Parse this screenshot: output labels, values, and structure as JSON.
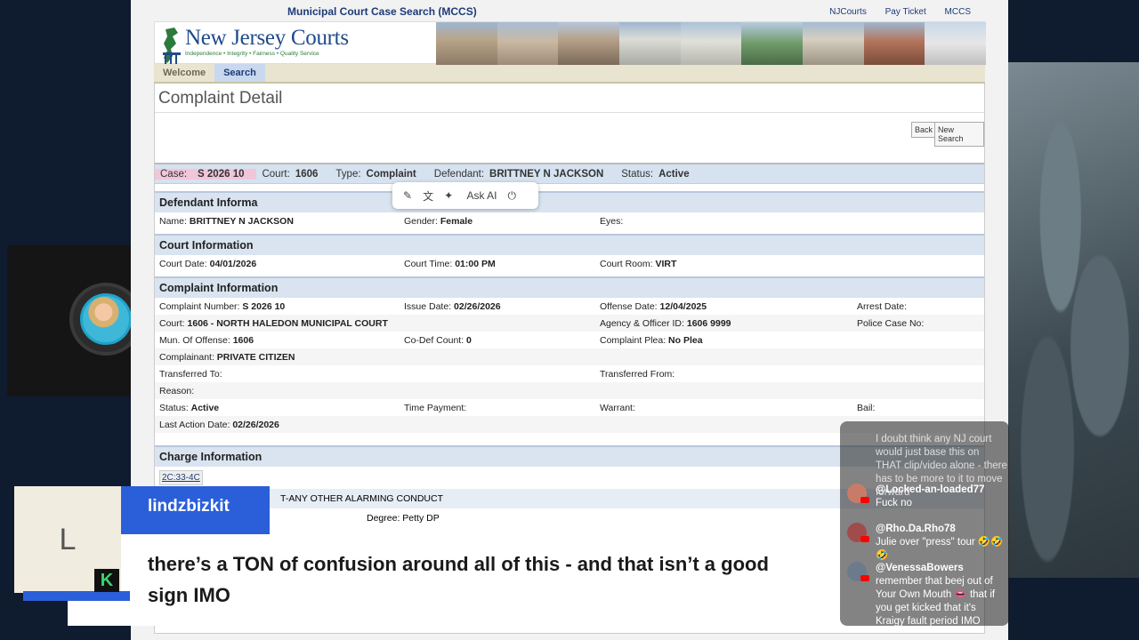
{
  "site": {
    "app_title": "Municipal Court Case Search (MCCS)",
    "nav": [
      "NJCourts",
      "Pay Ticket",
      "MCCS"
    ],
    "logo_text": "New Jersey Courts",
    "logo_tagline": "Independence • Integrity • Fairness • Quality Service",
    "tabs": [
      {
        "label": "Welcome"
      },
      {
        "label": "Search"
      }
    ],
    "page_title": "Complaint Detail",
    "buttons": {
      "back": "Back",
      "new_search": "New Search"
    }
  },
  "summary": {
    "case_label": "Case:",
    "case_value": "S 2026 10",
    "court_label": "Court:",
    "court_value": "1606",
    "type_label": "Type:",
    "type_value": "Complaint",
    "defendant_label": "Defendant:",
    "defendant_value": "BRITTNEY N JACKSON",
    "status_label": "Status:",
    "status_value": "Active"
  },
  "ai_toolbar": {
    "ask_ai": "Ask AI"
  },
  "defendant": {
    "title": "Defendant Informa",
    "name_label": "Name:",
    "name": "BRITTNEY N JACKSON",
    "gender_label": "Gender:",
    "gender": "Female",
    "eyes_label": "Eyes:",
    "eyes": ""
  },
  "court": {
    "title": "Court Information",
    "date_label": "Court Date:",
    "date": "04/01/2026",
    "time_label": "Court Time:",
    "time": "01:00 PM",
    "room_label": "Court Room:",
    "room": "VIRT"
  },
  "complaint": {
    "title": "Complaint Information",
    "number_label": "Complaint Number:",
    "number": "S 2026 10",
    "issue_label": "Issue Date:",
    "issue": "02/26/2026",
    "offense_date_label": "Offense Date:",
    "offense_date": "12/04/2025",
    "arrest_label": "Arrest Date:",
    "arrest": "",
    "court_label": "Court:",
    "court": "1606 - NORTH HALEDON MUNICIPAL COURT",
    "agency_label": "Agency & Officer ID:",
    "agency": "1606 9999",
    "police_label": "Police Case No:",
    "police": "",
    "mun_label": "Mun. Of Offense:",
    "mun": "1606",
    "codef_label": "Co-Def Count:",
    "codef": "0",
    "plea_label": "Complaint Plea:",
    "plea": "No Plea",
    "complainant_label": "Complainant:",
    "complainant": "PRIVATE CITIZEN",
    "transferred_to_label": "Transferred To:",
    "transferred_from_label": "Transferred From:",
    "reason_label": "Reason:",
    "status_label": "Status:",
    "status": "Active",
    "time_payment_label": "Time Payment:",
    "warrant_label": "Warrant:",
    "bail_label": "Bail:",
    "last_action_label": "Last Action Date:",
    "last_action": "02/26/2026"
  },
  "charge": {
    "title": "Charge Information",
    "statute": "2C:33-4C",
    "description": "T-ANY OTHER ALARMING CONDUCT",
    "degree_label": "Degree:",
    "degree": "Petty DP"
  },
  "chat": [
    {
      "user": "",
      "text": "I doubt think any NJ court would just base this on THAT clip/video alone - there has to be more to it to move forward"
    },
    {
      "user": "@Locked-an-loaded77",
      "text": "Fuck no"
    },
    {
      "user": "@Rho.Da.Rho78",
      "text": "Julie over \"press\" tour 🤣🤣🤣"
    },
    {
      "user": "@VenessaBowers",
      "text": "remember that beej out of Your Own Mouth 👄 that if you get kicked that it's Kraigy fault period IMO"
    }
  ],
  "lower_third": {
    "avatar_letter": "L",
    "badge": "K",
    "name": "lindzbizkit",
    "message": "there’s a TON of confusion around all of this - and that isn’t a good sign IMO"
  },
  "colors": {
    "nj_blue": "#1d3b78",
    "header_band": "#d9e4f0",
    "highlight": "#f1c6d9",
    "accent_blue": "#2b5fd9"
  }
}
